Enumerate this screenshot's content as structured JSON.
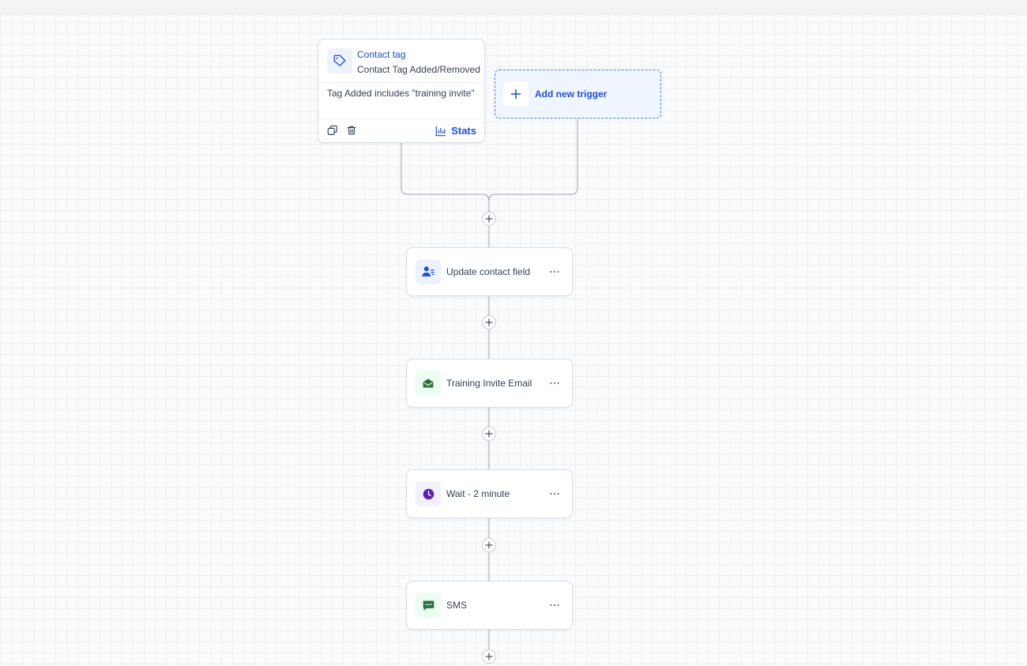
{
  "trigger": {
    "title": "Contact tag",
    "subtitle": "Contact Tag Added/Removed",
    "condition": "Tag Added includes \"training invite\"",
    "stats_label": "Stats",
    "icon": "tag-icon"
  },
  "add_trigger": {
    "label": "Add new trigger",
    "icon": "plus-icon"
  },
  "actions": [
    {
      "label": "Update contact field",
      "icon": "user-list-icon",
      "icon_color": "#1d4ed8",
      "icon_bg": "#eef2ff"
    },
    {
      "label": "Training Invite Email",
      "icon": "mail-open-icon",
      "icon_color": "#2f6f3e",
      "icon_bg": "#ecfdf3"
    },
    {
      "label": "Wait - 2 minute",
      "icon": "clock-icon",
      "icon_color": "#5b21b6",
      "icon_bg": "#f3f0ff"
    },
    {
      "label": "SMS",
      "icon": "message-icon",
      "icon_color": "#2f6f3e",
      "icon_bg": "#ecfdf3"
    }
  ],
  "colors": {
    "accent": "#1d4ed8",
    "connector": "#9ca3af",
    "grid": "#eceff3"
  }
}
